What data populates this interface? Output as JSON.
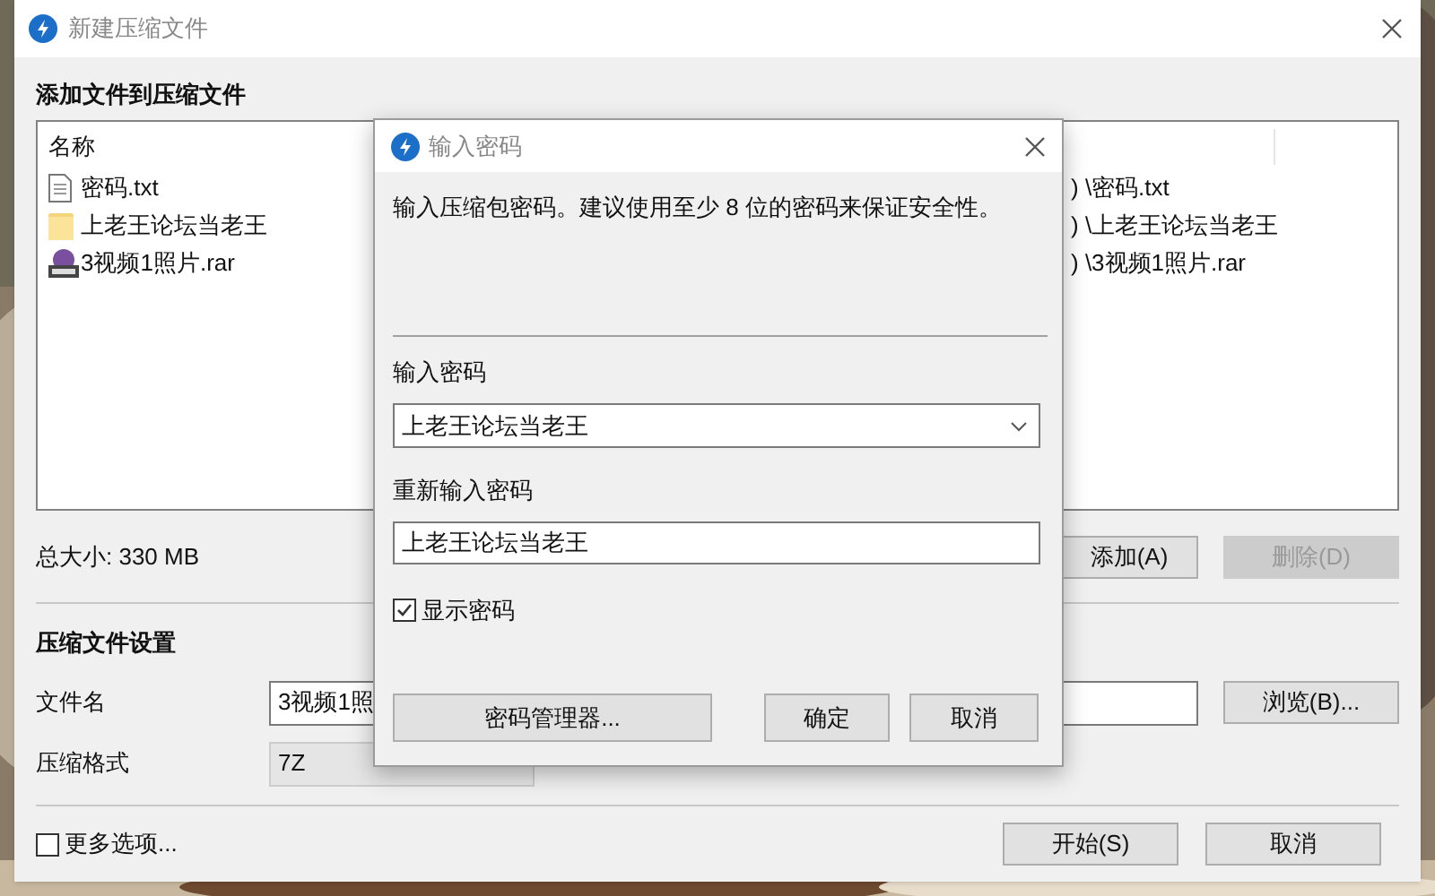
{
  "window": {
    "title": "新建压缩文件"
  },
  "section_files": {
    "title": "添加文件到压缩文件"
  },
  "file_list": {
    "columns": [
      "名称"
    ],
    "rows": [
      {
        "kind": "text",
        "name": "密码.txt",
        "column_2": ") \\密码.txt"
      },
      {
        "kind": "folder",
        "name": "上老王论坛当老王",
        "column_2": ") \\上老王论坛当老王"
      },
      {
        "kind": "archive",
        "name": "3视频1照片.rar",
        "column_2": ") \\3视频1照片.rar"
      }
    ]
  },
  "total_size": "总大小: 330 MB",
  "list_buttons": [
    {
      "label": "添加(A)",
      "disabled": false
    },
    {
      "label": "删除(D)",
      "disabled": true
    }
  ],
  "section_settings": {
    "title": "压缩文件设置"
  },
  "filename": {
    "label": "文件名",
    "value": "3视频1照",
    "browse": "浏览(B)..."
  },
  "format": {
    "label": "压缩格式",
    "value": "7Z"
  },
  "more_options": {
    "label": "更多选项...",
    "checked": false
  },
  "footer_buttons": [
    "开始(S)",
    "取消"
  ],
  "dialog": {
    "title": "输入密码",
    "message": "输入压缩包密码。建议使用至少 8 位的密码来保证安全性。",
    "password": {
      "label": "输入密码",
      "value": "上老王论坛当老王"
    },
    "confirm": {
      "label": "重新输入密码",
      "value": "上老王论坛当老王"
    },
    "show_password": {
      "label": "显示密码",
      "checked": true
    },
    "buttons": [
      {
        "kind": "manager",
        "label": "密码管理器..."
      },
      {
        "kind": "ok",
        "label": "确定"
      },
      {
        "kind": "cancel",
        "label": "取消"
      }
    ]
  }
}
